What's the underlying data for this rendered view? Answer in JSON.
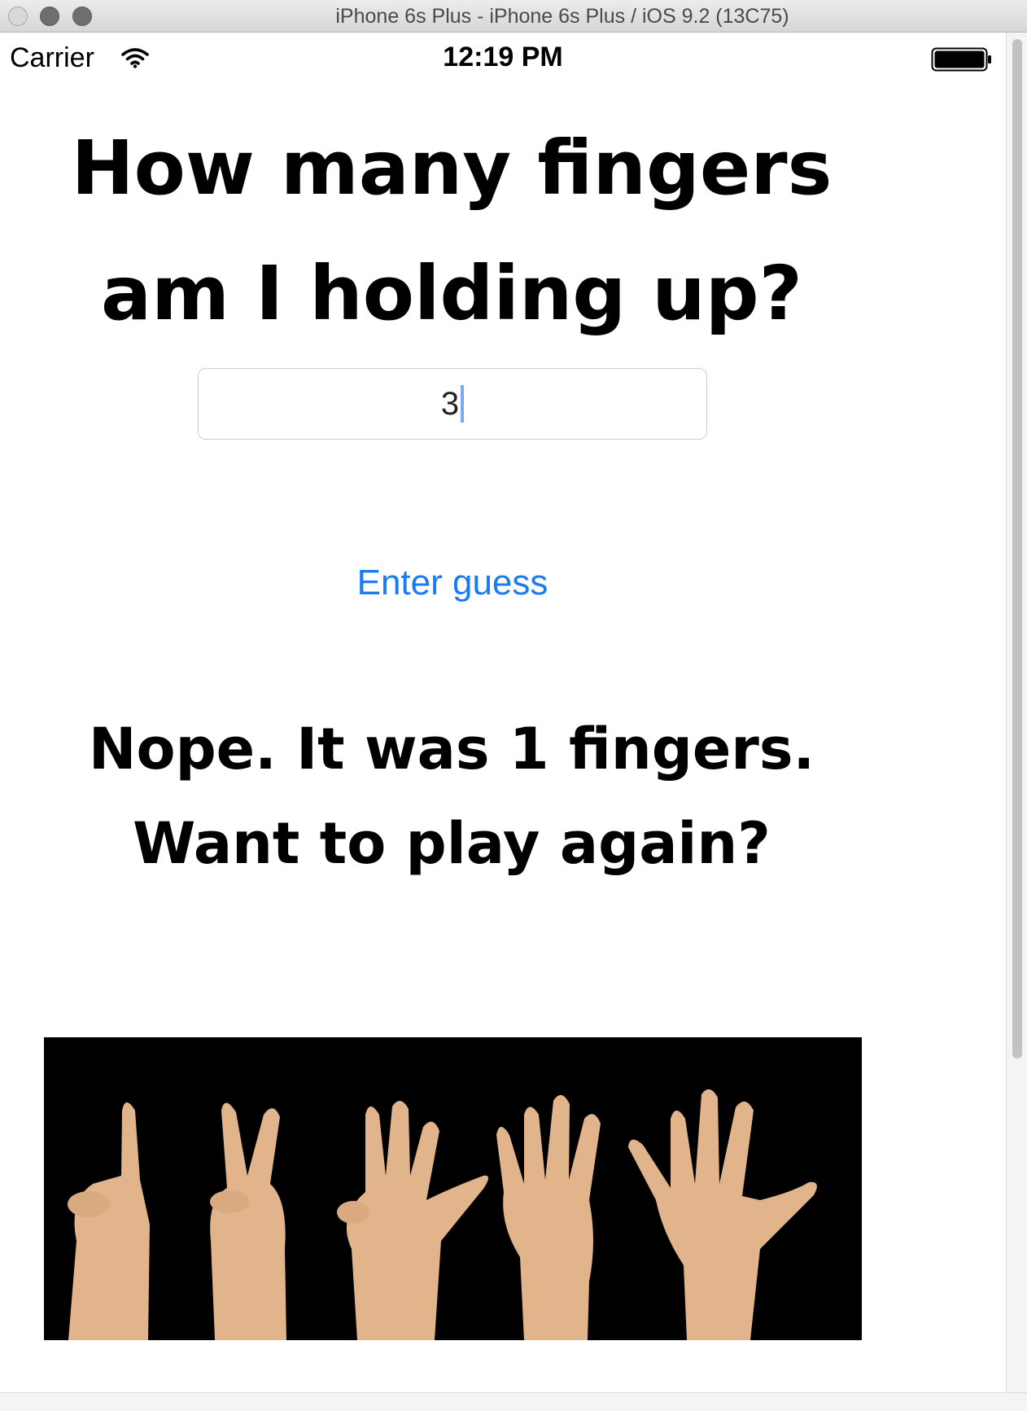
{
  "window": {
    "title": "iPhone 6s Plus - iPhone 6s Plus / iOS 9.2 (13C75)"
  },
  "status_bar": {
    "carrier": "Carrier",
    "time": "12:19 PM",
    "wifi_icon": "wifi-icon",
    "battery_icon": "battery-icon"
  },
  "app": {
    "question": "How many fingers am I holding up?",
    "guess_field": {
      "value": "3"
    },
    "enter_button_label": "Enter guess",
    "result_message": "Nope. It was 1 fingers. Want to play again?",
    "image": {
      "subject": "hands counting one to five fingers",
      "background_color": "#000000"
    }
  },
  "colors": {
    "accent": "#1a7cf2",
    "caret": "#7ea7f5"
  }
}
